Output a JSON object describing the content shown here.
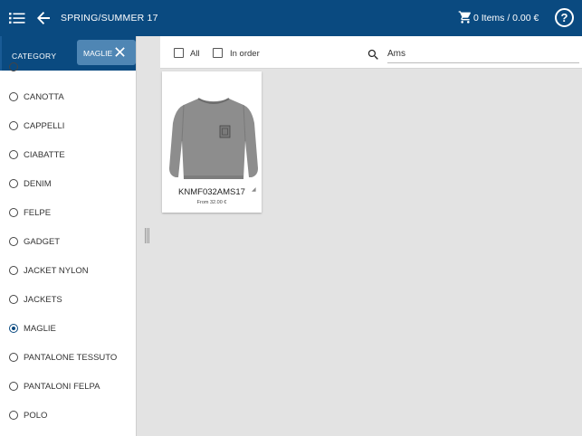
{
  "header": {
    "title": "SPRING/SUMMER 17",
    "cart_summary": "0 Items / 0.00 €",
    "help_glyph": "?",
    "background_color": "#0a4a80",
    "icons": {
      "menu": "list-icon",
      "back": "arrow-left-icon",
      "cart": "shopping-cart-icon",
      "help": "help-circle-icon"
    }
  },
  "sidebar": {
    "heading": "CATEGORY",
    "active_filter": {
      "label": "MAGLIE",
      "close_icon": "close-icon",
      "color": "#4f86b4"
    },
    "items": [
      {
        "label": "CANOTTA",
        "selected": false
      },
      {
        "label": "CAPPELLI",
        "selected": false
      },
      {
        "label": "CIABATTE",
        "selected": false
      },
      {
        "label": "DENIM",
        "selected": false
      },
      {
        "label": "FELPE",
        "selected": false
      },
      {
        "label": "GADGET",
        "selected": false
      },
      {
        "label": "JACKET NYLON",
        "selected": false
      },
      {
        "label": "JACKETS",
        "selected": false
      },
      {
        "label": "MAGLIE",
        "selected": true
      },
      {
        "label": "PANTALONE TESSUTO",
        "selected": false
      },
      {
        "label": "PANTALONI FELPA",
        "selected": false
      },
      {
        "label": "POLO",
        "selected": false
      }
    ]
  },
  "filters": {
    "all_label": "All",
    "all_checked": false,
    "in_order_label": "In order",
    "in_order_checked": false,
    "search_value": "Ams",
    "search_icon": "search-icon"
  },
  "products": [
    {
      "code": "KNMF032AMS17",
      "price": "From 32.00 €",
      "image": "grey-sweater-image"
    }
  ]
}
